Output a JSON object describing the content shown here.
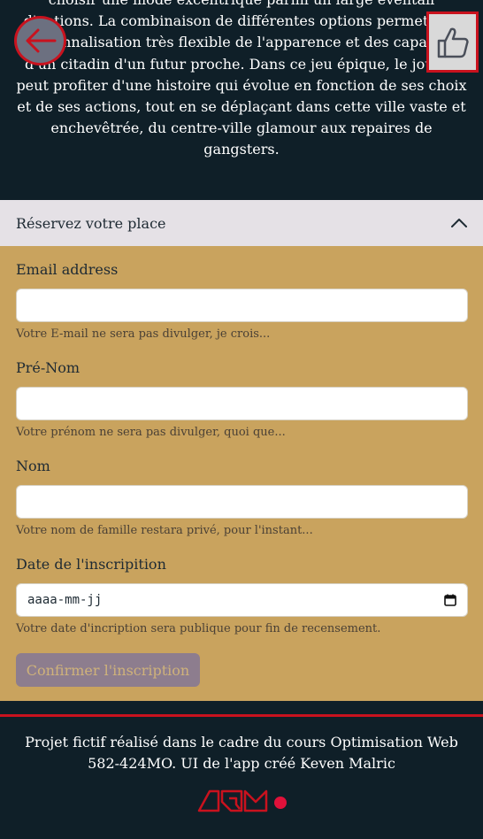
{
  "intro": {
    "text": "choisir une mode excentrique parmi un large éventail d'options. La combinaison de différentes options permet une personnalisation très flexible de l'apparence et des capacités d'un citadin d'un futur proche. Dans ce jeu épique, le joueur peut profiter d'une histoire qui évolue en fonction de ses choix et de ses actions, tout en se déplaçant dans cette ville vaste et enchevêtrée, du centre-ville glamour aux repaires de gangsters."
  },
  "nav": {
    "back_icon": "arrow-left-icon",
    "like_icon": "thumbs-up-icon"
  },
  "reservation": {
    "header": "Réservez votre place",
    "toggle_icon": "chevron-up-icon",
    "email": {
      "label": "Email address",
      "value": "",
      "help": "Votre E-mail ne sera pas divulger, je crois..."
    },
    "firstname": {
      "label": "Pré-Nom",
      "value": "",
      "help": "Votre prénom ne sera pas divulger, quoi que..."
    },
    "lastname": {
      "label": "Nom",
      "value": "",
      "help": "Votre nom de famille restara privé, pour l'instant..."
    },
    "date": {
      "label": "Date de l'inscripition",
      "value": "aaaa-mm-jj",
      "help": "Votre date d'incription sera publique pour fin de recensement.",
      "icon": "calendar-icon"
    },
    "submit_label": "Confirmer l'inscription"
  },
  "footer": {
    "text": "Projet fictif réalisé dans le cadre du cours Optimisation Web 582-424MO. UI de l'app créé Keven Malric",
    "logo_icon": "logo-icon"
  },
  "colors": {
    "background": "#0f1f28",
    "accent": "#c9121e",
    "form_bg": "#c9a35e",
    "header_bg": "#e5e1e6",
    "button_bg": "#8d7d8e"
  }
}
